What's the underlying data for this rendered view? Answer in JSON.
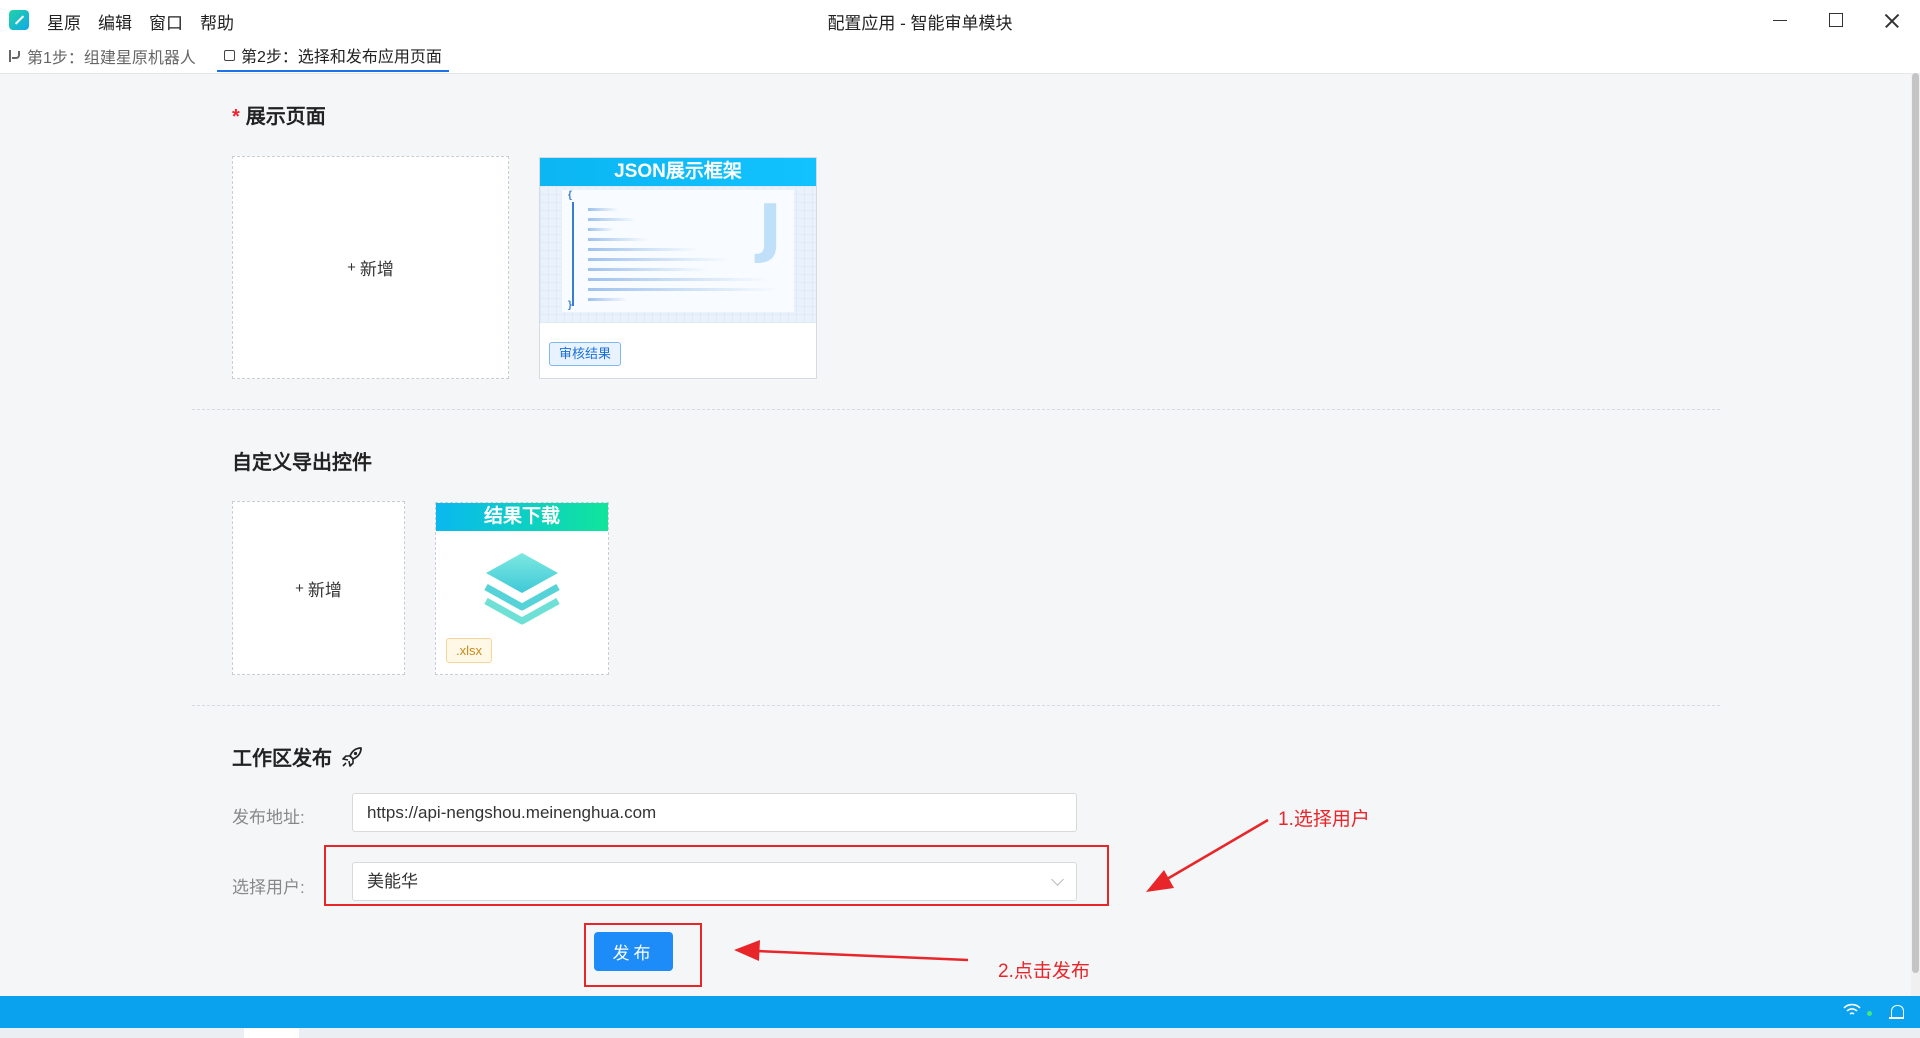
{
  "menu": [
    "星原",
    "编辑",
    "窗口",
    "帮助"
  ],
  "window_title": "配置应用 - 智能审单模块",
  "tabs": [
    {
      "label": "第1步：组建星原机器人",
      "icon": "branch-icon"
    },
    {
      "label": "第2步：选择和发布应用页面",
      "icon": "page-icon",
      "active": true
    }
  ],
  "display_pages": {
    "required_mark": "*",
    "title": "展示页面",
    "add_label": "新增",
    "add_symbol": "+",
    "cards": [
      {
        "header": "JSON展示框架",
        "tag": "审核结果",
        "preview_letter": "J",
        "brace_open": "{",
        "brace_close": "}"
      }
    ]
  },
  "export_controls": {
    "title": "自定义导出控件",
    "add_label": "新增",
    "add_symbol": "+",
    "cards": [
      {
        "header": "结果下载",
        "tag": ".xlsx"
      }
    ]
  },
  "workspace_publish": {
    "title": "工作区发布",
    "icon": "rocket-icon",
    "address_label": "发布地址:",
    "address_value": "https://api-nengshou.meinenghua.com",
    "user_label": "选择用户:",
    "user_value": "美能华",
    "publish_button": "发布"
  },
  "annotations": {
    "step1": "1.选择用户",
    "step2": "2.点击发布",
    "color": "#e8262a"
  },
  "colors": {
    "accent": "#1d8cf8",
    "statusbar": "#0aa2ef",
    "json_header": "#0bb6f2",
    "download_header_start": "#0ab8f0",
    "download_header_end": "#10e59b"
  }
}
